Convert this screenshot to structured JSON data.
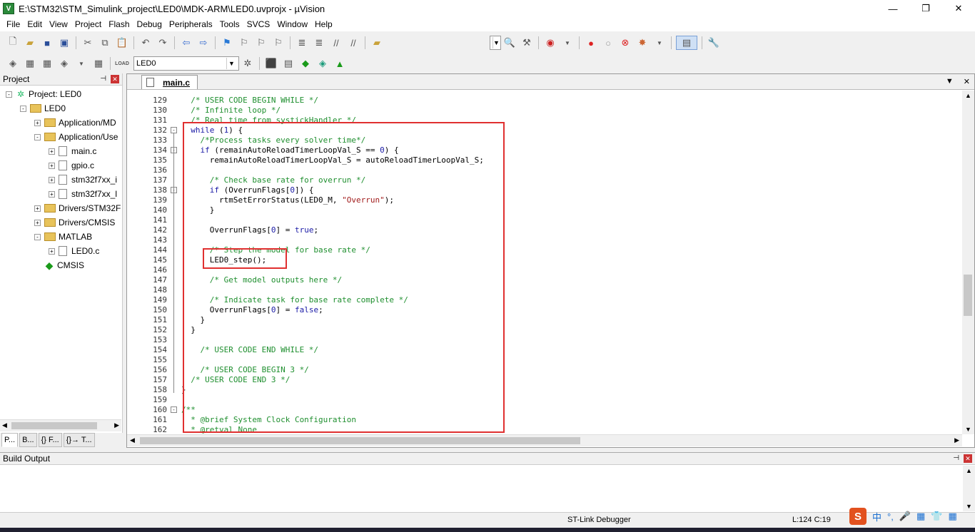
{
  "window": {
    "title": "E:\\STM32\\STM_Simulink_project\\LED0\\MDK-ARM\\LED0.uvprojx - µVision",
    "app_icon": "V",
    "minimize": "—",
    "restore": "❐",
    "close": "✕"
  },
  "menu": [
    "File",
    "Edit",
    "View",
    "Project",
    "Flash",
    "Debug",
    "Peripherals",
    "Tools",
    "SVCS",
    "Window",
    "Help"
  ],
  "toolbar2": {
    "target": "LED0",
    "load_label": "LOAD"
  },
  "project_panel": {
    "title": "Project",
    "tree": [
      {
        "label": "Project: LED0",
        "indent": 0,
        "type": "project",
        "exp": "-"
      },
      {
        "label": "LED0",
        "indent": 1,
        "type": "folder",
        "exp": "-"
      },
      {
        "label": "Application/MD",
        "indent": 2,
        "type": "folder",
        "exp": "+"
      },
      {
        "label": "Application/Use",
        "indent": 2,
        "type": "folder",
        "exp": "-"
      },
      {
        "label": "main.c",
        "indent": 3,
        "type": "file",
        "exp": "+"
      },
      {
        "label": "gpio.c",
        "indent": 3,
        "type": "file",
        "exp": "+"
      },
      {
        "label": "stm32f7xx_i",
        "indent": 3,
        "type": "file",
        "exp": "+"
      },
      {
        "label": "stm32f7xx_l",
        "indent": 3,
        "type": "file",
        "exp": "+"
      },
      {
        "label": "Drivers/STM32F",
        "indent": 2,
        "type": "folder",
        "exp": "+"
      },
      {
        "label": "Drivers/CMSIS",
        "indent": 2,
        "type": "folder",
        "exp": "+"
      },
      {
        "label": "MATLAB",
        "indent": 2,
        "type": "folder",
        "exp": "-"
      },
      {
        "label": "LED0.c",
        "indent": 3,
        "type": "file",
        "exp": "+"
      },
      {
        "label": "CMSIS",
        "indent": 2,
        "type": "cmsis",
        "exp": ""
      }
    ],
    "tabs": [
      "P...",
      "B...",
      "{} F...",
      "{}→ T..."
    ]
  },
  "editor": {
    "tab_label": "main.c",
    "first_line": 129,
    "lines": [
      {
        "t": "  /* USER CODE BEGIN WHILE */",
        "c": "cmt"
      },
      {
        "t": "  /* Infinite loop */",
        "c": "cmt"
      },
      {
        "t": "  /* Real time from systickHandler */",
        "c": "cmt"
      },
      {
        "t": "  while (1) {",
        "c": ""
      },
      {
        "t": "    /*Process tasks every solver time*/",
        "c": "cmt"
      },
      {
        "t": "    if (remainAutoReloadTimerLoopVal_S == 0) {",
        "c": ""
      },
      {
        "t": "      remainAutoReloadTimerLoopVal_S = autoReloadTimerLoopVal_S;",
        "c": ""
      },
      {
        "t": "",
        "c": ""
      },
      {
        "t": "      /* Check base rate for overrun */",
        "c": "cmt"
      },
      {
        "t": "      if (OverrunFlags[0]) {",
        "c": ""
      },
      {
        "t": "        rtmSetErrorStatus(LED0_M, \"Overrun\");",
        "c": ""
      },
      {
        "t": "      }",
        "c": ""
      },
      {
        "t": "",
        "c": ""
      },
      {
        "t": "      OverrunFlags[0] = true;",
        "c": ""
      },
      {
        "t": "",
        "c": ""
      },
      {
        "t": "      /* Step the model for base rate */",
        "c": "cmt"
      },
      {
        "t": "      LED0_step();",
        "c": ""
      },
      {
        "t": "",
        "c": ""
      },
      {
        "t": "      /* Get model outputs here */",
        "c": "cmt"
      },
      {
        "t": "",
        "c": ""
      },
      {
        "t": "      /* Indicate task for base rate complete */",
        "c": "cmt"
      },
      {
        "t": "      OverrunFlags[0] = false;",
        "c": ""
      },
      {
        "t": "    }",
        "c": ""
      },
      {
        "t": "  }",
        "c": ""
      },
      {
        "t": "",
        "c": ""
      },
      {
        "t": "    /* USER CODE END WHILE */",
        "c": "cmt"
      },
      {
        "t": "",
        "c": ""
      },
      {
        "t": "    /* USER CODE BEGIN 3 */",
        "c": "cmt"
      },
      {
        "t": "  /* USER CODE END 3 */",
        "c": "cmt"
      },
      {
        "t": "}",
        "c": ""
      },
      {
        "t": "",
        "c": ""
      },
      {
        "t": "/**",
        "c": "cmt"
      },
      {
        "t": "  * @brief System Clock Configuration",
        "c": "cmt"
      },
      {
        "t": "  * @retval None",
        "c": "cmt"
      }
    ]
  },
  "build_output": {
    "title": "Build Output"
  },
  "status": {
    "debugger": "ST-Link Debugger",
    "position": "L:124 C:19"
  },
  "ime": {
    "logo": "S",
    "lang": "中",
    "punct": "°,",
    "mic": "🎤",
    "keyboard": "▦",
    "skin": "👕",
    "menu": "▦"
  }
}
